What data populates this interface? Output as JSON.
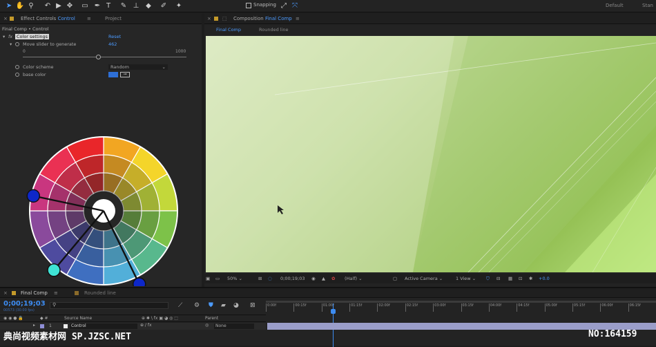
{
  "toolbar": {
    "snapping_label": "Snapping",
    "workspace_default": "Default",
    "workspace_standard": "Stan"
  },
  "left_panel": {
    "tab_effect_controls": "Effect Controls",
    "tab_effect_controls_layer": "Control",
    "tab_project": "Project",
    "breadcrumb": "Final Comp • Control",
    "effect_name": "Color settings",
    "reset_label": "Reset",
    "slider_label": "Move slider to generate",
    "slider_value": "462",
    "slider_min": "0",
    "slider_max": "1000",
    "slider_fraction": 0.462,
    "color_scheme_label": "Color scheme",
    "color_scheme_value": "Random",
    "base_color_label": "base color",
    "base_color": "#2e6fd6"
  },
  "color_wheel": {
    "colors": [
      "#f2a622",
      "#f4d52a",
      "#c3d83a",
      "#7dc249",
      "#58b88d",
      "#52afd9",
      "#3f6fc0",
      "#4e4b9f",
      "#8a4a9c",
      "#c9367f",
      "#ea3153",
      "#e9262a"
    ],
    "handle_colors": [
      "#0d27c8",
      "#3fe3d5",
      "#0d27c8"
    ]
  },
  "comp_panel": {
    "tab_label": "Composition",
    "tab_comp": "Final Comp",
    "subtab_final": "Final Comp",
    "subtab_rounded": "Rounded line",
    "zoom": "50%",
    "timecode": "0;00;19;03",
    "resolution": "(Half)",
    "camera": "Active Camera",
    "views": "1 View",
    "exposure": "+0.0"
  },
  "timeline": {
    "tab_final": "Final Comp",
    "tab_rounded": "Rounded line",
    "current_time": "0;00;19;03",
    "frame_info": "00573 (30.00 fps)",
    "search_placeholder": "",
    "col_source_name": "Source Name",
    "col_parent": "Parent",
    "layer_number": "1",
    "layer_name": "Control",
    "parent_value": "None",
    "ruler_labels": [
      "0:00f",
      "00:15f",
      "01:00f",
      "01:15f",
      "02:00f",
      "02:15f",
      "03:00f",
      "03:15f",
      "04:00f",
      "04:15f",
      "05:00f",
      "05:15f",
      "06:00f",
      "06:15f",
      "07:00f"
    ]
  },
  "watermark": {
    "left": "典尚视频素材网 SP.JZSC.NET",
    "right": "NO:164159"
  }
}
